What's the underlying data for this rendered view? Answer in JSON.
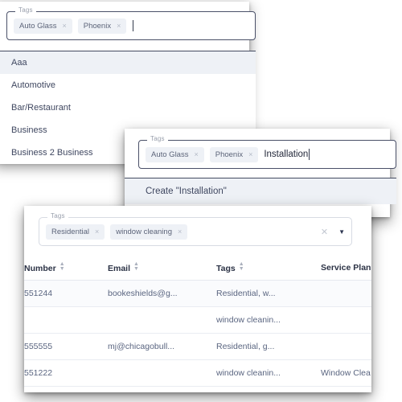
{
  "panel1": {
    "field": {
      "legend": "Tags",
      "chips": [
        {
          "label": "Auto Glass",
          "remove": "×"
        },
        {
          "label": "Phoenix",
          "remove": "×"
        }
      ],
      "input_value": "",
      "placeholder": ""
    },
    "options": [
      {
        "label": "Aaa",
        "selected": true
      },
      {
        "label": "Automotive",
        "selected": false
      },
      {
        "label": "Bar/Restaurant",
        "selected": false
      },
      {
        "label": "Business",
        "selected": false
      },
      {
        "label": "Business 2 Business",
        "selected": false
      }
    ]
  },
  "panel2": {
    "field": {
      "legend": "Tags",
      "chips": [
        {
          "label": "Auto Glass",
          "remove": "×"
        },
        {
          "label": "Phoenix",
          "remove": "×"
        }
      ],
      "input_value": "Installation"
    },
    "options": [
      {
        "label": "Create \"Installation\"",
        "selected": true
      }
    ],
    "cursor": {
      "icon": "pointing-hand-click-cursor"
    }
  },
  "panel3": {
    "field": {
      "legend": "Tags",
      "chips": [
        {
          "label": "Residential",
          "remove": "×"
        },
        {
          "label": "window cleaning",
          "remove": "×"
        }
      ],
      "clear_icon": "✕",
      "dropdown_icon": "▼"
    },
    "table": {
      "columns": [
        {
          "label": "Number",
          "sort": "▴▾"
        },
        {
          "label": "Email",
          "sort": "▴▾"
        },
        {
          "label": "Tags",
          "sort": "▴▾"
        },
        {
          "label": "Service Plan",
          "sort": ""
        }
      ],
      "rows": [
        {
          "number": "551244",
          "email": "bookeshields@g...",
          "tags": "Residential, w...",
          "service_plan": ""
        },
        {
          "number": "",
          "email": "",
          "tags": "window cleanin...",
          "service_plan": ""
        },
        {
          "number": "555555",
          "email": "mj@chicagobull...",
          "tags": "Residential, g...",
          "service_plan": ""
        },
        {
          "number": "551222",
          "email": "",
          "tags": "window cleanin...",
          "service_plan": "Window Clea"
        }
      ]
    }
  },
  "colors": {
    "chip_bg": "#eef1f6",
    "chip_text": "#5c6479",
    "field_border": "#4a5068",
    "option_selected_bg": "#eef1f6",
    "table_header_text": "#2b3245",
    "table_cell_text": "#5a6580"
  }
}
